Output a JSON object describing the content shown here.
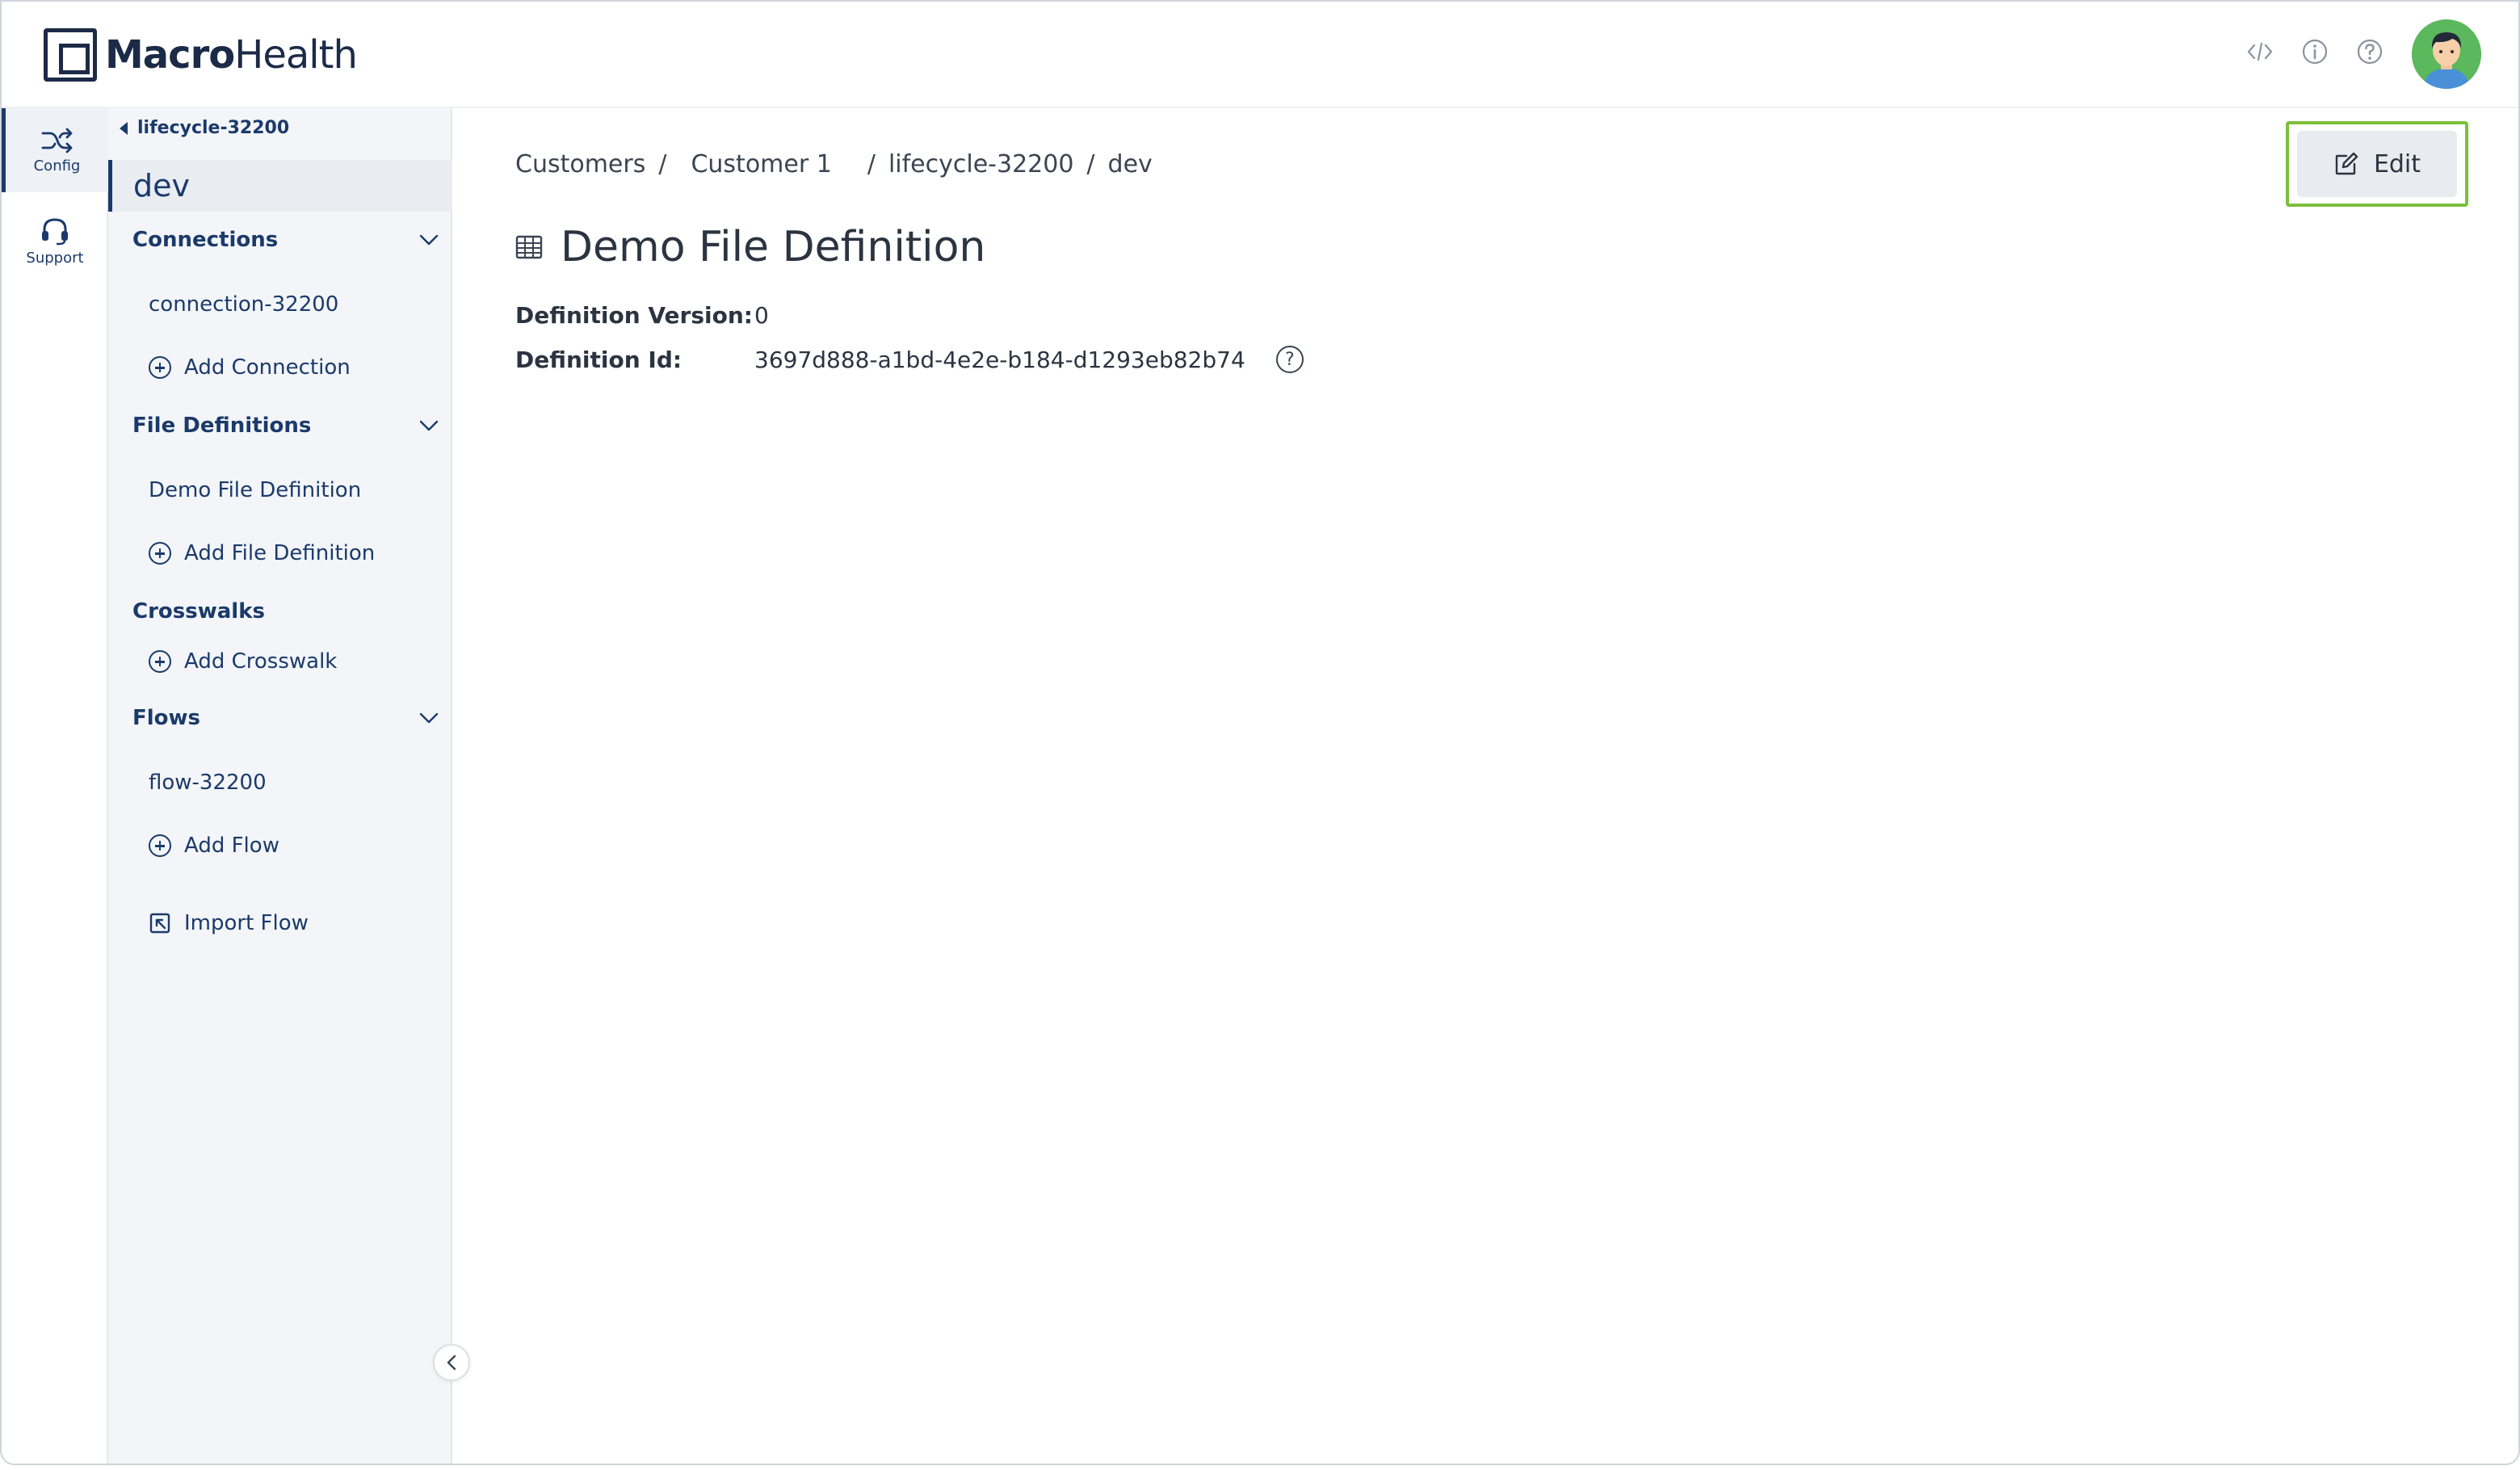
{
  "header": {
    "brand_bold": "Macro",
    "brand_regular": "Health",
    "icons": [
      "code-icon",
      "info-icon",
      "help-icon",
      "avatar"
    ]
  },
  "rail": {
    "items": [
      {
        "label": "Config",
        "icon": "shuffle-icon",
        "active": true
      },
      {
        "label": "Support",
        "icon": "headset-icon",
        "active": false
      }
    ]
  },
  "sidebar": {
    "back_label": "lifecycle-32200",
    "env_title": "dev",
    "connections": {
      "heading": "Connections",
      "items": [
        "connection-32200"
      ],
      "add_label": "Add Connection"
    },
    "file_definitions": {
      "heading": "File Definitions",
      "items": [
        "Demo File Definition"
      ],
      "add_label": "Add File Definition"
    },
    "crosswalks": {
      "heading": "Crosswalks",
      "add_label": "Add Crosswalk"
    },
    "flows": {
      "heading": "Flows",
      "items": [
        "flow-32200"
      ],
      "add_label": "Add Flow",
      "import_label": "Import Flow"
    }
  },
  "main": {
    "breadcrumb": [
      "Customers",
      "Customer 1",
      "lifecycle-32200",
      "dev"
    ],
    "edit_label": "Edit",
    "title": "Demo File Definition",
    "definition_version_label": "Definition Version:",
    "definition_version": "0",
    "definition_id_label": "Definition Id:",
    "definition_id": "3697d888-a1bd-4e2e-b184-d1293eb82b74"
  },
  "colors": {
    "brand_navy": "#1b3a6b",
    "highlight_green": "#7cbf3b",
    "sidebar_bg": "#f3f5f8"
  }
}
